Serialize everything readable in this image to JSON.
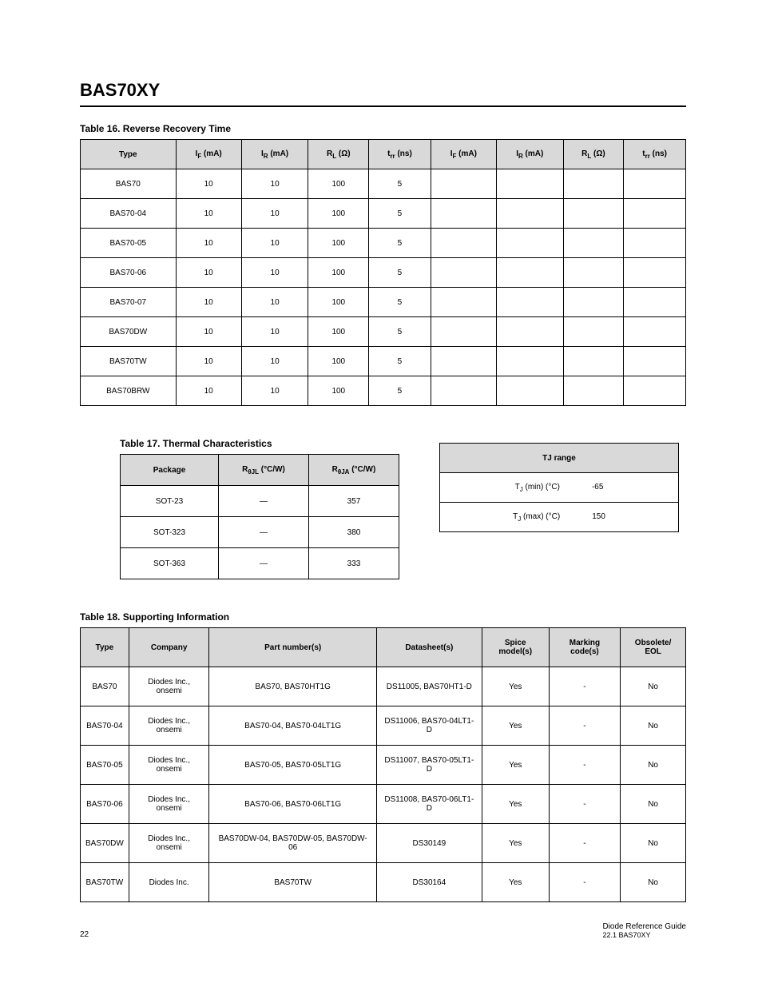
{
  "page": {
    "title": "BAS70XY",
    "table16": {
      "title": "Table 16.  Reverse Recovery Time",
      "headers": [
        "Type",
        "IF (mA)",
        "IR (mA)",
        "RL (Ω)",
        "trr (ns)",
        "IF (mA)",
        "IR (mA)",
        "RL (Ω)",
        "trr (ns)"
      ],
      "rows": [
        [
          "BAS70",
          "10",
          "10",
          "100",
          "5",
          "",
          "",
          "",
          ""
        ],
        [
          "BAS70-04",
          "10",
          "10",
          "100",
          "5",
          "",
          "",
          "",
          ""
        ],
        [
          "BAS70-05",
          "10",
          "10",
          "100",
          "5",
          "",
          "",
          "",
          ""
        ],
        [
          "BAS70-06",
          "10",
          "10",
          "100",
          "5",
          "",
          "",
          "",
          ""
        ],
        [
          "BAS70-07",
          "10",
          "10",
          "100",
          "5",
          "",
          "",
          "",
          ""
        ],
        [
          "BAS70DW",
          "10",
          "10",
          "100",
          "5",
          "",
          "",
          "",
          ""
        ],
        [
          "BAS70TW",
          "10",
          "10",
          "100",
          "5",
          "",
          "",
          "",
          ""
        ],
        [
          "BAS70BRW",
          "10",
          "10",
          "100",
          "5",
          "",
          "",
          "",
          ""
        ]
      ]
    },
    "table17": {
      "title": "Table 17.  Thermal Characteristics",
      "headers": [
        "Package",
        "RθJL (°C/W)",
        "RθJA (°C/W)"
      ],
      "rows": [
        [
          "SOT-23",
          "—",
          "357"
        ],
        [
          "SOT-323",
          "—",
          "380"
        ],
        [
          "SOT-363",
          "—",
          "333"
        ]
      ]
    },
    "table17b": {
      "header": "TJ range",
      "rows": [
        {
          "k": "TJ (min) (°C)",
          "v": "-65"
        },
        {
          "k": "TJ (max) (°C)",
          "v": "150"
        }
      ]
    },
    "table18": {
      "title": "Table 18.  Supporting Information",
      "headers": [
        "Type",
        "Company",
        "Part number(s)",
        "Datasheet(s)",
        "Spice model(s)",
        "Marking code(s)",
        "Obsolete/ EOL"
      ],
      "rows": [
        [
          "BAS70",
          "Diodes Inc., onsemi",
          "BAS70, BAS70HT1G",
          "DS11005, BAS70HT1-D",
          "Yes",
          "-",
          "No"
        ],
        [
          "BAS70-04",
          "Diodes Inc., onsemi",
          "BAS70-04, BAS70-04LT1G",
          "DS11006, BAS70-04LT1-D",
          "Yes",
          "-",
          "No"
        ],
        [
          "BAS70-05",
          "Diodes Inc., onsemi",
          "BAS70-05, BAS70-05LT1G",
          "DS11007, BAS70-05LT1-D",
          "Yes",
          "-",
          "No"
        ],
        [
          "BAS70-06",
          "Diodes Inc., onsemi",
          "BAS70-06, BAS70-06LT1G",
          "DS11008, BAS70-06LT1-D",
          "Yes",
          "-",
          "No"
        ],
        [
          "BAS70DW",
          "Diodes Inc., onsemi",
          "BAS70DW-04, BAS70DW-05, BAS70DW-06",
          "DS30149",
          "Yes",
          "-",
          "No"
        ],
        [
          "BAS70TW",
          "Diodes Inc.",
          "BAS70TW",
          "DS30164",
          "Yes",
          "-",
          "No"
        ]
      ]
    },
    "footer_left": "22",
    "footer_right_1": "Diode Reference Guide",
    "footer_right_2": "22.1 BAS70XY"
  }
}
